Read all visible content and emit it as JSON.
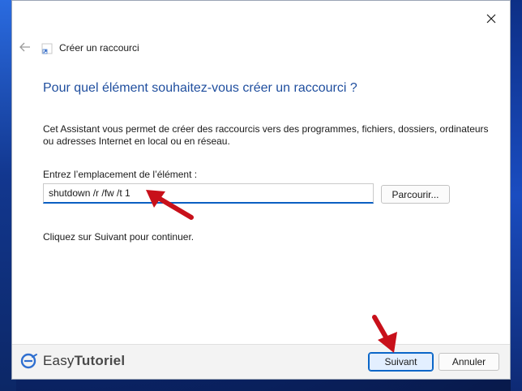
{
  "window": {
    "title": "Créer un raccourci"
  },
  "wizard": {
    "heading": "Pour quel élément souhaitez-vous créer un raccourci ?",
    "description": "Cet Assistant vous permet de créer des raccourcis vers des programmes, fichiers, dossiers, ordinateurs ou adresses Internet en local ou en réseau.",
    "location_label": "Entrez l’emplacement de l’élément :",
    "location_value": "shutdown /r /fw /t 1",
    "browse_label": "Parcourir...",
    "hint": "Cliquez sur Suivant pour continuer."
  },
  "footer": {
    "logo_prefix": "Easy",
    "logo_bold": "Tutoriel",
    "next_label": "Suivant",
    "cancel_label": "Annuler"
  },
  "colors": {
    "heading": "#1f4e9e",
    "accent": "#0a5fc2",
    "annotation_arrow": "#c8101a"
  }
}
